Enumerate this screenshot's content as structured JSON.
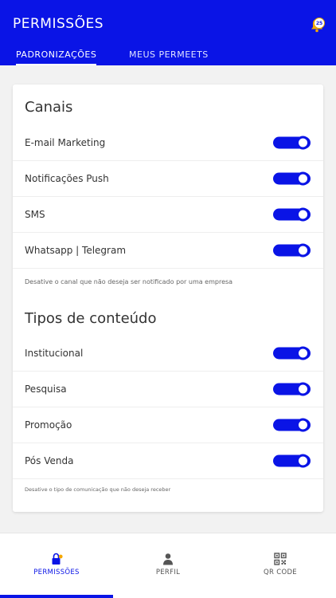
{
  "header": {
    "title": "PERMISSÕES",
    "badge": "25",
    "accent_color": "#0a14e6",
    "badge_icon": "bell-icon"
  },
  "tabs": [
    {
      "label": "PADRONIZAÇÕES",
      "active": true
    },
    {
      "label": "MEUS PERMEETS",
      "active": false
    }
  ],
  "channels": {
    "title": "Canais",
    "items": [
      {
        "label": "E-mail Marketing",
        "enabled": true
      },
      {
        "label": "Notificações Push",
        "enabled": true
      },
      {
        "label": "SMS",
        "enabled": true
      },
      {
        "label": "Whatsapp | Telegram",
        "enabled": true
      }
    ],
    "hint": "Desative o canal que não deseja ser notificado por uma empresa"
  },
  "content_types": {
    "title": "Tipos de conteúdo",
    "items": [
      {
        "label": "Institucional",
        "enabled": true
      },
      {
        "label": "Pesquisa",
        "enabled": true
      },
      {
        "label": "Promoção",
        "enabled": true
      },
      {
        "label": "Pós Venda",
        "enabled": true
      }
    ],
    "hint": "Desative o tipo de comunicação que não deseja receber"
  },
  "bottom_nav": [
    {
      "label": "PERMISSÕES",
      "icon": "lock-icon",
      "active": true
    },
    {
      "label": "PERFIL",
      "icon": "person-icon",
      "active": false
    },
    {
      "label": "QR CODE",
      "icon": "qr-code-icon",
      "active": false
    }
  ]
}
